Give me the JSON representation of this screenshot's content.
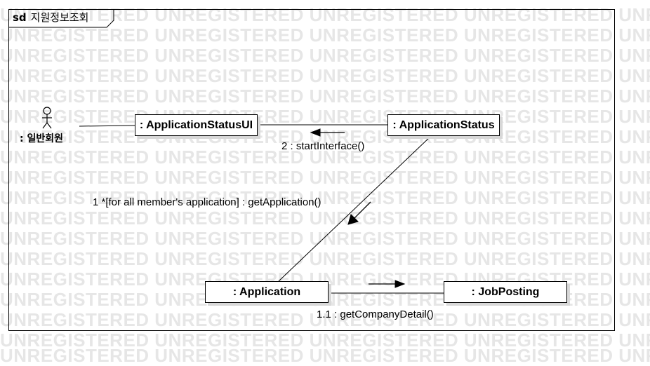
{
  "watermark": "UNREGISTERED UNREGISTERED UNREGISTERED UNREGISTERED UNREGISTERED UNREGISTERED",
  "diagram": {
    "kind_label": "sd",
    "name": "지원정보조회"
  },
  "actor": {
    "label": ": 일반회원"
  },
  "lifelines": {
    "ui": ": ApplicationStatusUI",
    "status": ": ApplicationStatus",
    "application": ": Application",
    "job_posting": ": JobPosting"
  },
  "messages": {
    "m1": "1 *[for all member's application] : getApplication()",
    "m11": "1.1 : getCompanyDetail()",
    "m2": "2 : startInterface()"
  }
}
